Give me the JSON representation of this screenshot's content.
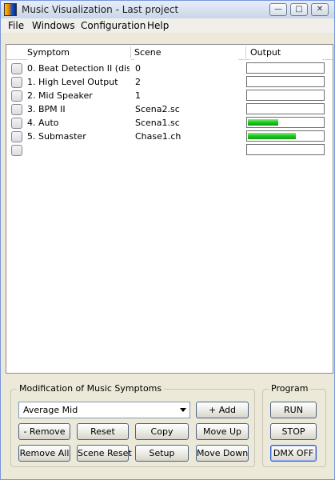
{
  "window": {
    "title": "Music Visualization - Last project",
    "minimize_glyph": "—",
    "maximize_glyph": "□",
    "close_glyph": "✕"
  },
  "menu": [
    "File",
    "Windows",
    "Configuration",
    "Help"
  ],
  "table": {
    "headers": {
      "symptom": "Symptom",
      "scene": "Scene",
      "output": "Output"
    },
    "rows": [
      {
        "symptom": "0. Beat Detection II (dis...",
        "scene": "0",
        "output_level": 0
      },
      {
        "symptom": "1. High Level Output",
        "scene": "2",
        "output_level": 0
      },
      {
        "symptom": "2. Mid Speaker",
        "scene": "1",
        "output_level": 0
      },
      {
        "symptom": "3. BPM II",
        "scene": "Scena2.sc",
        "output_level": 0
      },
      {
        "symptom": "4. Auto",
        "scene": "Scena1.sc",
        "output_level": 0.4
      },
      {
        "symptom": "5. Submaster",
        "scene": "Chase1.ch",
        "output_level": 0.64
      },
      {
        "symptom": "",
        "scene": "",
        "output_level": 0
      }
    ]
  },
  "modification": {
    "title": "Modification of Music Symptoms",
    "selected_symptom": "Average Mid",
    "buttons": {
      "add": "+ Add",
      "remove": "- Remove",
      "reset": "Reset",
      "copy": "Copy",
      "move_up": "Move Up",
      "remove_all": "Remove All",
      "scene_reset": "Scene Reset",
      "setup": "Setup",
      "move_down": "Move Down"
    }
  },
  "program": {
    "title": "Program",
    "run": "RUN",
    "stop": "STOP",
    "dmx_off": "DMX OFF"
  },
  "colors": {
    "meter_fill": "#1ec41e"
  }
}
